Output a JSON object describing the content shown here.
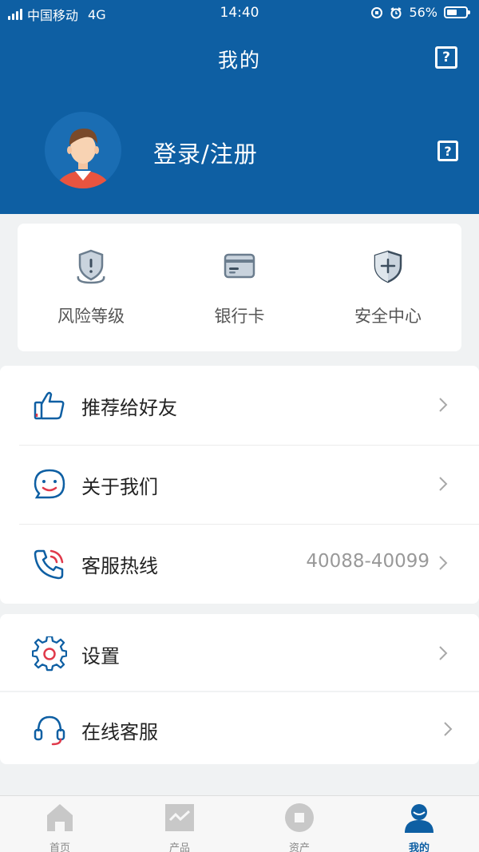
{
  "status_bar": {
    "carrier": "中国移动",
    "network": "4G",
    "time": "14:40",
    "battery": "56%",
    "battery_level": 0.56
  },
  "nav": {
    "title": "我的",
    "help_icon": "question-mark-icon"
  },
  "profile": {
    "login_text": "登录/注册",
    "avatar_icon": "user-avatar-icon"
  },
  "quick_actions": [
    {
      "label": "风险等级",
      "icon": "shield-alert-icon"
    },
    {
      "label": "银行卡",
      "icon": "credit-card-icon"
    },
    {
      "label": "安全中心",
      "icon": "shield-plus-icon"
    }
  ],
  "menu_group_1": [
    {
      "label": "推荐给好友",
      "icon": "thumbs-up-icon",
      "value": ""
    },
    {
      "label": "关于我们",
      "icon": "smile-chat-icon",
      "value": ""
    },
    {
      "label": "客服热线",
      "icon": "phone-call-icon",
      "value": "40088-40099"
    }
  ],
  "menu_group_2": [
    {
      "label": "设置",
      "icon": "gear-icon"
    },
    {
      "label": "在线客服",
      "icon": "headset-icon"
    }
  ],
  "tabbar": [
    {
      "label": "首页",
      "icon": "home-icon",
      "active": false
    },
    {
      "label": "产品",
      "icon": "chart-icon",
      "active": false
    },
    {
      "label": "资产",
      "icon": "coin-icon",
      "active": false
    },
    {
      "label": "我的",
      "icon": "user-icon",
      "active": true
    }
  ],
  "colors": {
    "primary": "#0e5fa3",
    "accent_red": "#e0394a",
    "background": "#f0f2f3"
  }
}
